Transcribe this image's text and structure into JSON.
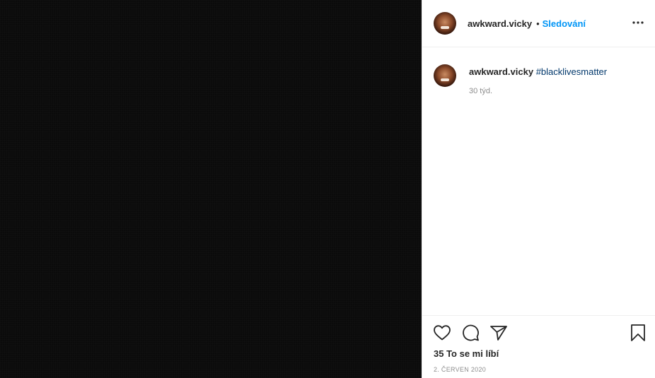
{
  "post": {
    "header": {
      "username": "awkward.vicky",
      "separator": "•",
      "follow_label": "Sledování",
      "more_icon": "more-horizontal-icon"
    },
    "caption": {
      "username": "awkward.vicky",
      "hashtag": "#blacklivesmatter",
      "time_ago": "30 týd."
    },
    "actions": {
      "like_icon": "heart-icon",
      "comment_icon": "comment-icon",
      "share_icon": "send-icon",
      "save_icon": "bookmark-icon"
    },
    "likes_text": "35 To se mi líbí",
    "date": "2. ČERVEN 2020",
    "colors": {
      "link_blue": "#0095f6",
      "hashtag": "#00376b",
      "text": "#262626",
      "muted": "#8e8e8e",
      "media_bg": "#0b0b0b"
    }
  }
}
